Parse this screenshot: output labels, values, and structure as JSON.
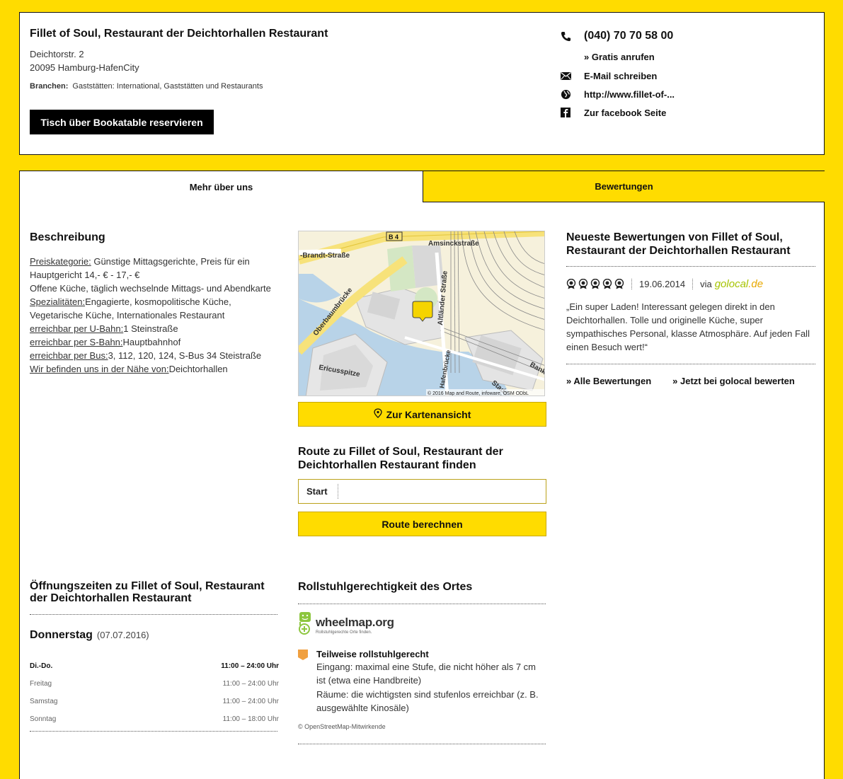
{
  "business": {
    "name": "Fillet of Soul, Restaurant der Deichtorhallen Restaurant",
    "street": "Deichtorstr. 2",
    "city": "20095 Hamburg-HafenCity",
    "branchen_label": "Branchen:",
    "branchen_value": "Gaststätten: International, Gaststätten und Restaurants",
    "book_button": "Tisch über Bookatable reservieren"
  },
  "contact": {
    "phone": "(040) 70 70 58 00",
    "call_free": "»  Gratis anrufen",
    "email": "E-Mail schreiben",
    "website": "http://www.fillet-of-...",
    "facebook": "Zur facebook Seite"
  },
  "tabs": {
    "more": "Mehr über uns",
    "reviews": "Bewertungen"
  },
  "description": {
    "title": "Beschreibung",
    "price_label": "Preiskategorie:",
    "price_value": " Günstige Mittagsgerichte, Preis für ein Hauptgericht 14,- € - 17,- €",
    "kitchen": "Offene Küche, täglich wechselnde Mittags- und Abendkarte",
    "special_label": "Spezialitäten:",
    "special_value": "Engagierte, kosmopolitische Küche, Vegetarische Küche, Internationales Restaurant",
    "ubahn_label": "erreichbar per U-Bahn:",
    "ubahn_value": "1 Steinstraße",
    "sbahn_label": "erreichbar per S-Bahn:",
    "sbahn_value": "Hauptbahnhof",
    "bus_label": "erreichbar per Bus:",
    "bus_value": "3, 112, 120, 124, S-Bus 34 Steistraße",
    "near_label": "Wir befinden uns in der Nähe von:",
    "near_value": "Deichtorhallen"
  },
  "map": {
    "street_amsinck": "Amsinckstraße",
    "street_brandt": "-Brandt-Straße",
    "street_oberbaum": "Oberbaumbrücke",
    "street_altlaender": "Altländer Straße",
    "street_ericus": "Ericusspitze",
    "street_hafen": "Hafenbrücke",
    "street_bank": "Bank",
    "street_stads": "Stads",
    "road_badge": "B 4",
    "copyright": "© 2016 Map and Route, infoware, OSM ODbL",
    "button": "Zur Kartenansicht"
  },
  "route": {
    "title": "Route zu Fillet of Soul, Restaurant der Deichtorhallen Restaurant finden",
    "start_label": "Start",
    "start_value": "",
    "button": "Route berechnen"
  },
  "reviews": {
    "title": "Neueste Bewertungen von Fillet of Soul, Restaurant der Deichtorhallen Restaurant",
    "rating": 5,
    "date": "19.06.2014",
    "via": "via",
    "source_part1": "golocal",
    "source_part2": ".de",
    "text": "„Ein super Laden! Interessant gelegen direkt in den Deichtorhallen. Tolle und originelle Küche, super sympathisches Personal, klasse Atmosphäre. Auf jeden Fall einen Besuch wert!“",
    "all_link": "» Alle Bewertungen",
    "rate_link": "» Jetzt bei golocal bewerten"
  },
  "hours": {
    "title": "Öffnungszeiten zu Fillet of Soul, Restaurant der Deichtorhallen Restaurant",
    "day": "Donnerstag",
    "date": "(07.07.2016)",
    "rows": [
      {
        "days": "Di.-Do.",
        "time": "11:00 – 24:00 Uhr"
      },
      {
        "days": "Freitag",
        "time": "11:00 – 24:00 Uhr"
      },
      {
        "days": "Samstag",
        "time": "11:00 – 24:00 Uhr"
      },
      {
        "days": "Sonntag",
        "time": "11:00 – 18:00 Uhr"
      }
    ]
  },
  "wheelchair": {
    "title": "Rollstuhlgerechtigkeit des Ortes",
    "logo_name": "wheelmap.org",
    "logo_sub": "Rollstuhlgerechte Orte finden.",
    "status": "Teilweise rollstuhlgerecht",
    "entrance": "Eingang: maximal eine Stufe, die nicht höher als 7 cm ist (etwa eine Handbreite)",
    "rooms": "Räume: die wichtigsten sind stufenlos erreichbar (z. B. ausgewählte Kinosäle)",
    "osm": "© OpenStreetMap-Mitwirkende"
  },
  "colors": {
    "brand_yellow": "#ffdc00",
    "marker_yellow": "#f5d400",
    "wheel_partial": "#f0a040"
  }
}
